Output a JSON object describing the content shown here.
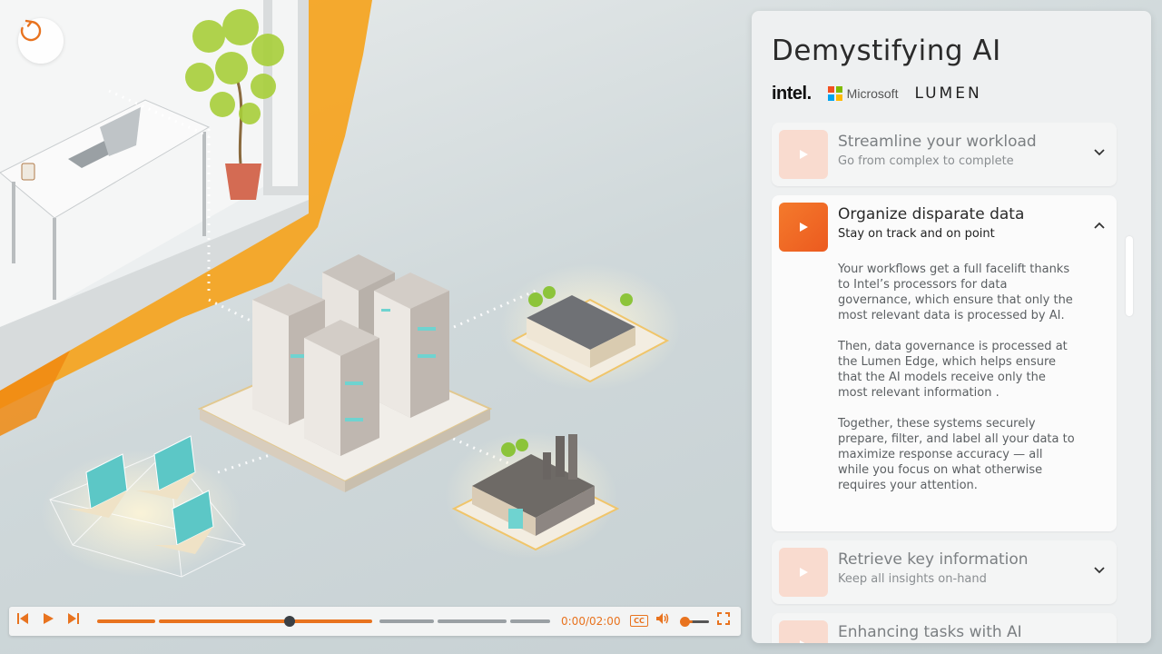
{
  "panel": {
    "title": "Demystifying AI",
    "logos": {
      "intel": "intel.",
      "microsoft": "Microsoft",
      "lumen": "LUMEN"
    },
    "cards": [
      {
        "title": "Streamline your workload",
        "subtitle": "Go from complex to complete",
        "state": "collapsed"
      },
      {
        "title": "Organize disparate data",
        "subtitle": "Stay on track and on point",
        "state": "expanded",
        "body": [
          "Your workflows get a full facelift thanks to Intel’s processors for data governance, which ensure that only the most relevant data is processed by AI.",
          "Then, data governance is processed at the Lumen Edge, which helps ensure that the AI models receive only the most relevant information .",
          "Together, these systems securely prepare, filter, and label all your data to maximize response accuracy — all while you focus on what  otherwise requires your attention."
        ]
      },
      {
        "title": "Retrieve key information",
        "subtitle": "Keep all insights on-hand",
        "state": "collapsed"
      },
      {
        "title": "Enhancing tasks with AI",
        "state": "collapsed"
      }
    ]
  },
  "player": {
    "time": "0:00/02:00",
    "cc_label": "CC",
    "progress_fraction": 0.42,
    "volume_fraction": 0.4
  },
  "colors": {
    "accent": "#e8731f",
    "panel_bg": "#eef0f1"
  },
  "icons": [
    "replay-icon",
    "skip-back-icon",
    "play-icon",
    "skip-forward-icon",
    "volume-icon",
    "fullscreen-icon",
    "chevron-down-icon",
    "chevron-up-icon"
  ]
}
